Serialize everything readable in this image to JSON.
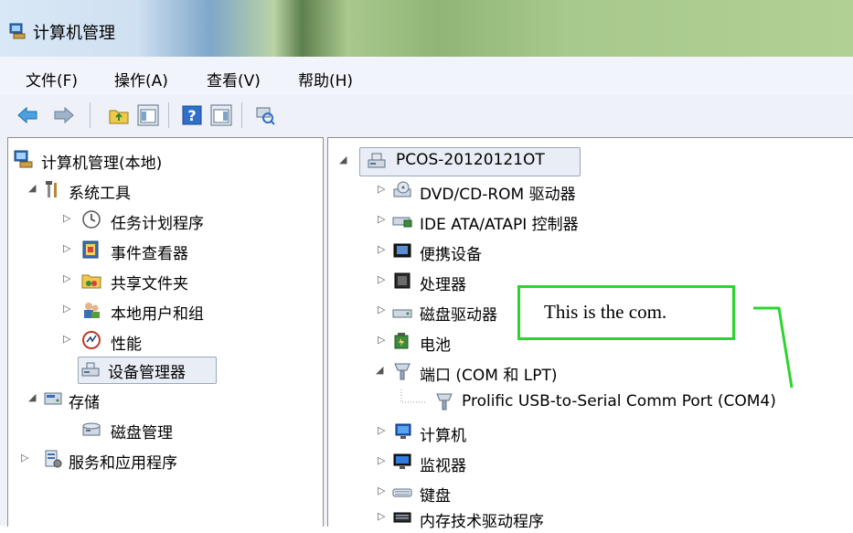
{
  "window": {
    "title": "计算机管理"
  },
  "menu": [
    {
      "label": "文件(F)"
    },
    {
      "label": "操作(A)"
    },
    {
      "label": "查看(V)"
    },
    {
      "label": "帮助(H)"
    }
  ],
  "toolbar": {
    "buttons": [
      {
        "icon": "back-arrow-icon"
      },
      {
        "icon": "forward-arrow-icon"
      },
      {
        "icon": "up-folder-icon"
      },
      {
        "icon": "show-hide-console-tree-icon"
      },
      {
        "icon": "help-icon"
      },
      {
        "icon": "show-hide-action-pane-icon"
      },
      {
        "icon": "scan-hardware-icon"
      }
    ]
  },
  "left_tree": [
    {
      "label": "计算机管理(本地)",
      "icon": "computer-management-icon"
    },
    {
      "label": "系统工具",
      "icon": "system-tools-icon",
      "expanded": true
    },
    {
      "label": "任务计划程序",
      "icon": "clock-icon"
    },
    {
      "label": "事件查看器",
      "icon": "event-viewer-icon"
    },
    {
      "label": "共享文件夹",
      "icon": "shared-folder-icon"
    },
    {
      "label": "本地用户和组",
      "icon": "users-icon"
    },
    {
      "label": "性能",
      "icon": "performance-icon"
    },
    {
      "label": "设备管理器",
      "icon": "device-manager-icon",
      "selected": true
    },
    {
      "label": "存储",
      "icon": "storage-icon",
      "expanded": true
    },
    {
      "label": "磁盘管理",
      "icon": "disk-management-icon"
    },
    {
      "label": "服务和应用程序",
      "icon": "services-icon"
    }
  ],
  "right_tree": [
    {
      "label": "PCOS-20120121OT",
      "icon": "computer-root-icon",
      "expanded": true
    },
    {
      "label": "DVD/CD-ROM 驱动器",
      "icon": "dvd-drive-icon"
    },
    {
      "label": "IDE ATA/ATAPI 控制器",
      "icon": "ide-controller-icon"
    },
    {
      "label": "便携设备",
      "icon": "portable-device-icon"
    },
    {
      "label": "处理器",
      "icon": "processor-icon"
    },
    {
      "label": "磁盘驱动器",
      "icon": "disk-drive-icon"
    },
    {
      "label": "电池",
      "icon": "battery-icon"
    },
    {
      "label": "端口 (COM 和 LPT)",
      "icon": "port-icon",
      "expanded": true
    },
    {
      "label": "Prolific USB-to-Serial Comm Port (COM4)",
      "icon": "serial-port-icon"
    },
    {
      "label": "计算机",
      "icon": "computer-icon"
    },
    {
      "label": "监视器",
      "icon": "monitor-icon"
    },
    {
      "label": "键盘",
      "icon": "keyboard-icon"
    },
    {
      "label": "内存技术驱动程序",
      "icon": "memory-icon"
    }
  ],
  "callout": {
    "text": "This is the com.",
    "color": "#2ed42e"
  }
}
